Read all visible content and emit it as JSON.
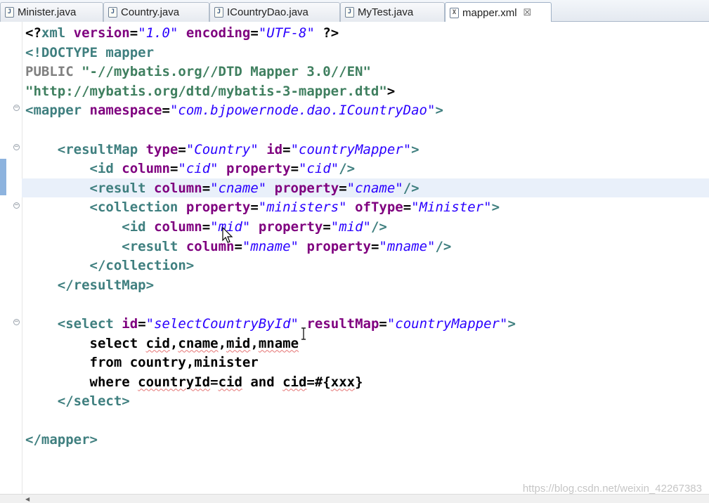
{
  "tabs": [
    {
      "label": "Minister.java",
      "icon": "java-file-icon",
      "glyph": "J"
    },
    {
      "label": "Country.java",
      "icon": "java-file-icon",
      "glyph": "J"
    },
    {
      "label": "ICountryDao.java",
      "icon": "java-file-icon",
      "glyph": "J"
    },
    {
      "label": "MyTest.java",
      "icon": "java-file-icon",
      "glyph": "J"
    },
    {
      "label": "mapper.xml",
      "icon": "xml-file-icon",
      "glyph": "X",
      "active": true,
      "close": "☒"
    }
  ],
  "code": {
    "lines": [
      [
        [
          "p",
          "<?"
        ],
        [
          "t",
          "xml"
        ],
        [
          "p",
          " "
        ],
        [
          "a",
          "version"
        ],
        [
          "p",
          "="
        ],
        [
          "v",
          "\"1.0\""
        ],
        [
          "p",
          " "
        ],
        [
          "a",
          "encoding"
        ],
        [
          "p",
          "="
        ],
        [
          "v",
          "\"UTF-8\""
        ],
        [
          "p",
          " ?>"
        ]
      ],
      [
        [
          "doctype",
          "<!DOCTYPE "
        ],
        [
          "t",
          "mapper"
        ]
      ],
      [
        [
          "pub",
          "PUBLIC "
        ],
        [
          "str",
          "\"-//mybatis.org//DTD Mapper 3.0//EN\""
        ]
      ],
      [
        [
          "str",
          "\"http://mybatis.org/dtd/mybatis-3-mapper.dtd\""
        ],
        [
          "p",
          ">"
        ]
      ],
      [
        [
          "t",
          "<mapper"
        ],
        [
          "p",
          " "
        ],
        [
          "a",
          "namespace"
        ],
        [
          "p",
          "="
        ],
        [
          "v",
          "\"com.bjpowernode.dao.ICountryDao\""
        ],
        [
          "t",
          ">"
        ]
      ],
      [],
      [
        [
          "p",
          "    "
        ],
        [
          "t",
          "<resultMap"
        ],
        [
          "p",
          " "
        ],
        [
          "a",
          "type"
        ],
        [
          "p",
          "="
        ],
        [
          "v",
          "\"Country\""
        ],
        [
          "p",
          " "
        ],
        [
          "a",
          "id"
        ],
        [
          "p",
          "="
        ],
        [
          "v",
          "\"countryMapper\""
        ],
        [
          "t",
          ">"
        ]
      ],
      [
        [
          "p",
          "        "
        ],
        [
          "t",
          "<id"
        ],
        [
          "p",
          " "
        ],
        [
          "a",
          "column"
        ],
        [
          "p",
          "="
        ],
        [
          "v",
          "\"cid\""
        ],
        [
          "p",
          " "
        ],
        [
          "a",
          "property"
        ],
        [
          "p",
          "="
        ],
        [
          "v",
          "\"cid\""
        ],
        [
          "t",
          "/>"
        ]
      ],
      [
        [
          "p",
          "        "
        ],
        [
          "t",
          "<result"
        ],
        [
          "p",
          " "
        ],
        [
          "a",
          "column"
        ],
        [
          "p",
          "="
        ],
        [
          "v",
          "\"cname\""
        ],
        [
          "p",
          " "
        ],
        [
          "a",
          "property"
        ],
        [
          "p",
          "="
        ],
        [
          "v",
          "\"cname\""
        ],
        [
          "t",
          "/>"
        ]
      ],
      [
        [
          "p",
          "        "
        ],
        [
          "t",
          "<collection"
        ],
        [
          "p",
          " "
        ],
        [
          "a",
          "property"
        ],
        [
          "p",
          "="
        ],
        [
          "v",
          "\"ministers\""
        ],
        [
          "p",
          " "
        ],
        [
          "a",
          "ofType"
        ],
        [
          "p",
          "="
        ],
        [
          "v",
          "\"Minister\""
        ],
        [
          "t",
          ">"
        ]
      ],
      [
        [
          "p",
          "            "
        ],
        [
          "t",
          "<id"
        ],
        [
          "p",
          " "
        ],
        [
          "a",
          "column"
        ],
        [
          "p",
          "="
        ],
        [
          "v",
          "\"mid\""
        ],
        [
          "p",
          " "
        ],
        [
          "a",
          "property"
        ],
        [
          "p",
          "="
        ],
        [
          "v",
          "\"mid\""
        ],
        [
          "t",
          "/>"
        ]
      ],
      [
        [
          "p",
          "            "
        ],
        [
          "t",
          "<result"
        ],
        [
          "p",
          " "
        ],
        [
          "a",
          "column"
        ],
        [
          "p",
          "="
        ],
        [
          "v",
          "\"mname\""
        ],
        [
          "p",
          " "
        ],
        [
          "a",
          "property"
        ],
        [
          "p",
          "="
        ],
        [
          "v",
          "\"mname\""
        ],
        [
          "t",
          "/>"
        ]
      ],
      [
        [
          "p",
          "        "
        ],
        [
          "t",
          "</collection>"
        ]
      ],
      [
        [
          "p",
          "    "
        ],
        [
          "t",
          "</resultMap>"
        ]
      ],
      [],
      [
        [
          "p",
          "    "
        ],
        [
          "t",
          "<select"
        ],
        [
          "p",
          " "
        ],
        [
          "a",
          "id"
        ],
        [
          "p",
          "="
        ],
        [
          "v",
          "\"selectCountryById\""
        ],
        [
          "p",
          " "
        ],
        [
          "a",
          "resultMap"
        ],
        [
          "p",
          "="
        ],
        [
          "v",
          "\"countryMapper\""
        ],
        [
          "t",
          ">"
        ]
      ],
      [
        [
          "p",
          "        select "
        ],
        [
          "sq",
          "cid"
        ],
        [
          "p",
          ","
        ],
        [
          "sq",
          "cname"
        ],
        [
          "p",
          ","
        ],
        [
          "sq",
          "mid"
        ],
        [
          "p",
          ","
        ],
        [
          "sq",
          "mname"
        ]
      ],
      [
        [
          "p",
          "        from country,minister"
        ]
      ],
      [
        [
          "p",
          "        where "
        ],
        [
          "sq",
          "countryId"
        ],
        [
          "p",
          "="
        ],
        [
          "sq",
          "cid"
        ],
        [
          "p",
          " and "
        ],
        [
          "sq",
          "cid"
        ],
        [
          "p",
          "=#{"
        ],
        [
          "sq",
          "xxx"
        ],
        [
          "p",
          "}"
        ]
      ],
      [
        [
          "p",
          "    "
        ],
        [
          "t",
          "</select>"
        ]
      ],
      [],
      [
        [
          "t",
          "</mapper>"
        ]
      ]
    ],
    "current_line": 8
  },
  "watermark": "https://blog.csdn.net/weixin_42267383",
  "colors": {
    "tag": "#3f7f7f",
    "attribute": "#7f007f",
    "value": "#2a00ff",
    "current_line": "#e9f0fa"
  }
}
